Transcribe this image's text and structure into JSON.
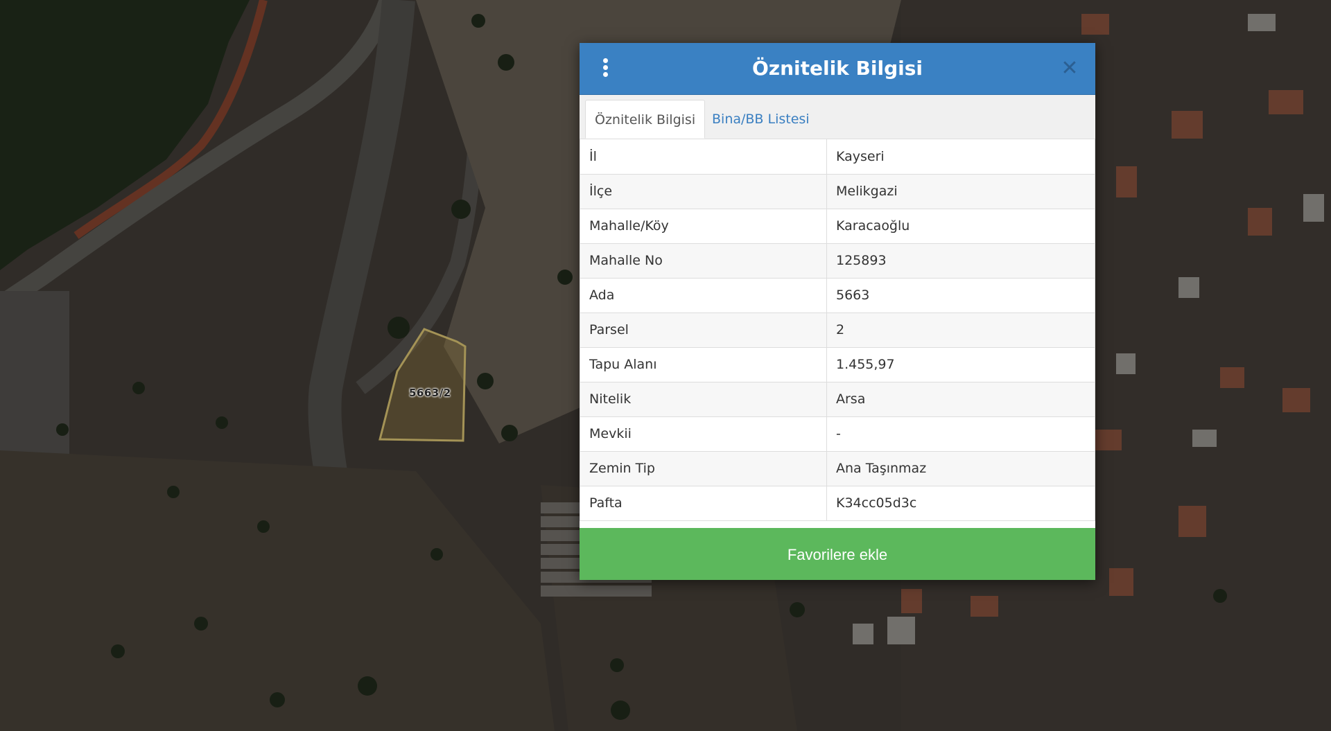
{
  "map": {
    "parcel_label": "5663/2"
  },
  "dialog": {
    "title": "Öznitelik Bilgisi",
    "menu_icon": "vertical-ellipsis-icon",
    "close_icon": "close-icon",
    "header_color": "#3a81c3",
    "tabs": [
      {
        "label": "Öznitelik Bilgisi",
        "active": true
      },
      {
        "label": "Bina/BB Listesi",
        "active": false
      }
    ],
    "attributes": [
      {
        "key": "İl",
        "value": "Kayseri"
      },
      {
        "key": "İlçe",
        "value": "Melikgazi"
      },
      {
        "key": "Mahalle/Köy",
        "value": "Karacaoğlu"
      },
      {
        "key": "Mahalle No",
        "value": "125893"
      },
      {
        "key": "Ada",
        "value": "5663"
      },
      {
        "key": "Parsel",
        "value": "2"
      },
      {
        "key": "Tapu Alanı",
        "value": "1.455,97"
      },
      {
        "key": "Nitelik",
        "value": "Arsa"
      },
      {
        "key": "Mevkii",
        "value": "-"
      },
      {
        "key": "Zemin Tip",
        "value": "Ana Taşınmaz"
      },
      {
        "key": "Pafta",
        "value": "K34cc05d3c"
      }
    ],
    "favorite_button": "Favorilere ekle",
    "favorite_color": "#5cb85c"
  }
}
